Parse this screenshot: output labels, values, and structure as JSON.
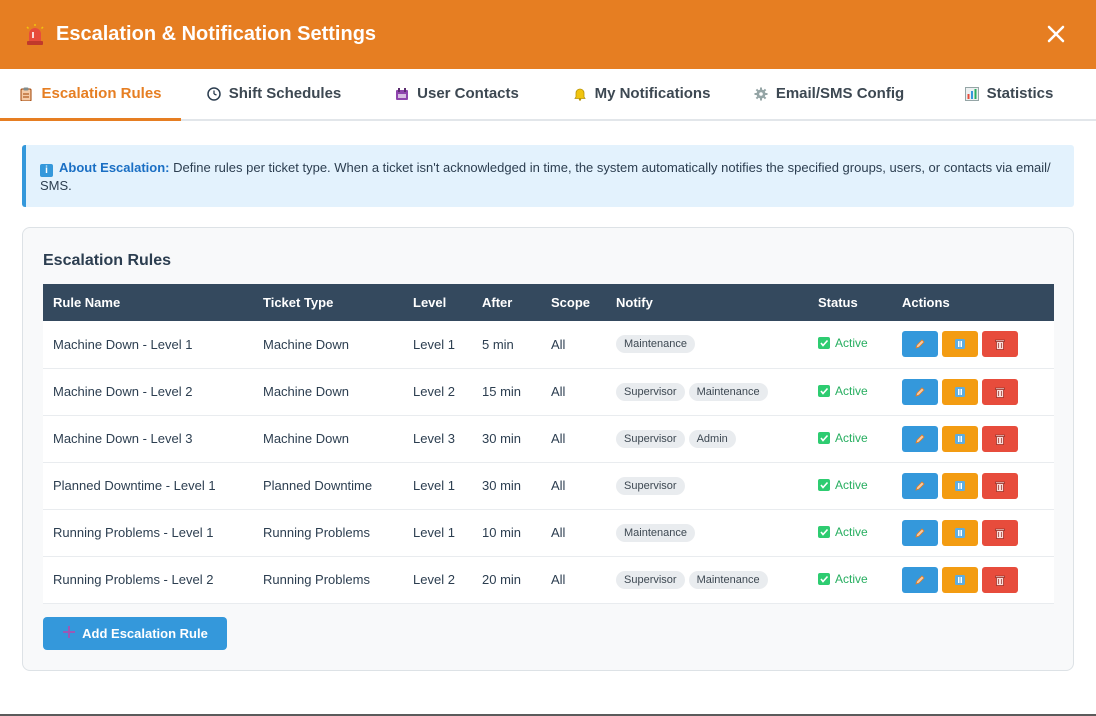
{
  "header": {
    "title": "Escalation & Notification Settings"
  },
  "tabs": [
    {
      "label": "Escalation Rules",
      "icon": "clipboard-icon",
      "active": true
    },
    {
      "label": "Shift Schedules",
      "icon": "clock-icon",
      "active": false
    },
    {
      "label": "User Contacts",
      "icon": "contacts-icon",
      "active": false
    },
    {
      "label": "My Notifications",
      "icon": "bell-icon",
      "active": false
    },
    {
      "label": "Email/SMS Config",
      "icon": "gear-icon",
      "active": false
    },
    {
      "label": "Statistics",
      "icon": "bar-chart-icon",
      "active": false
    }
  ],
  "info": {
    "heading": "About Escalation:",
    "text": "Define rules per ticket type. When a ticket isn't acknowledged in time, the system automatically notifies the specified groups, users, or contacts via email/ SMS."
  },
  "rules": {
    "title": "Escalation Rules",
    "columns": [
      "Rule Name",
      "Ticket Type",
      "Level",
      "After",
      "Scope",
      "Notify",
      "Status",
      "Actions"
    ],
    "rows": [
      {
        "name": "Machine Down - Level 1",
        "type": "Machine Down",
        "level": "Level 1",
        "after": "5 min",
        "scope": "All",
        "notify": [
          "Maintenance"
        ],
        "status": "Active"
      },
      {
        "name": "Machine Down - Level 2",
        "type": "Machine Down",
        "level": "Level 2",
        "after": "15 min",
        "scope": "All",
        "notify": [
          "Supervisor",
          "Maintenance"
        ],
        "status": "Active"
      },
      {
        "name": "Machine Down - Level 3",
        "type": "Machine Down",
        "level": "Level 3",
        "after": "30 min",
        "scope": "All",
        "notify": [
          "Supervisor",
          "Admin"
        ],
        "status": "Active"
      },
      {
        "name": "Planned Downtime - Level 1",
        "type": "Planned Downtime",
        "level": "Level 1",
        "after": "30 min",
        "scope": "All",
        "notify": [
          "Supervisor"
        ],
        "status": "Active"
      },
      {
        "name": "Running Problems - Level 1",
        "type": "Running Problems",
        "level": "Level 1",
        "after": "10 min",
        "scope": "All",
        "notify": [
          "Maintenance"
        ],
        "status": "Active"
      },
      {
        "name": "Running Problems - Level 2",
        "type": "Running Problems",
        "level": "Level 2",
        "after": "20 min",
        "scope": "All",
        "notify": [
          "Supervisor",
          "Maintenance"
        ],
        "status": "Active"
      }
    ],
    "add_label": "Add Escalation Rule"
  },
  "colors": {
    "accent": "#e67e22",
    "table_header": "#34495e",
    "edit": "#3498db",
    "pause": "#f39c12",
    "delete": "#e74c3c",
    "active": "#27ae60"
  }
}
